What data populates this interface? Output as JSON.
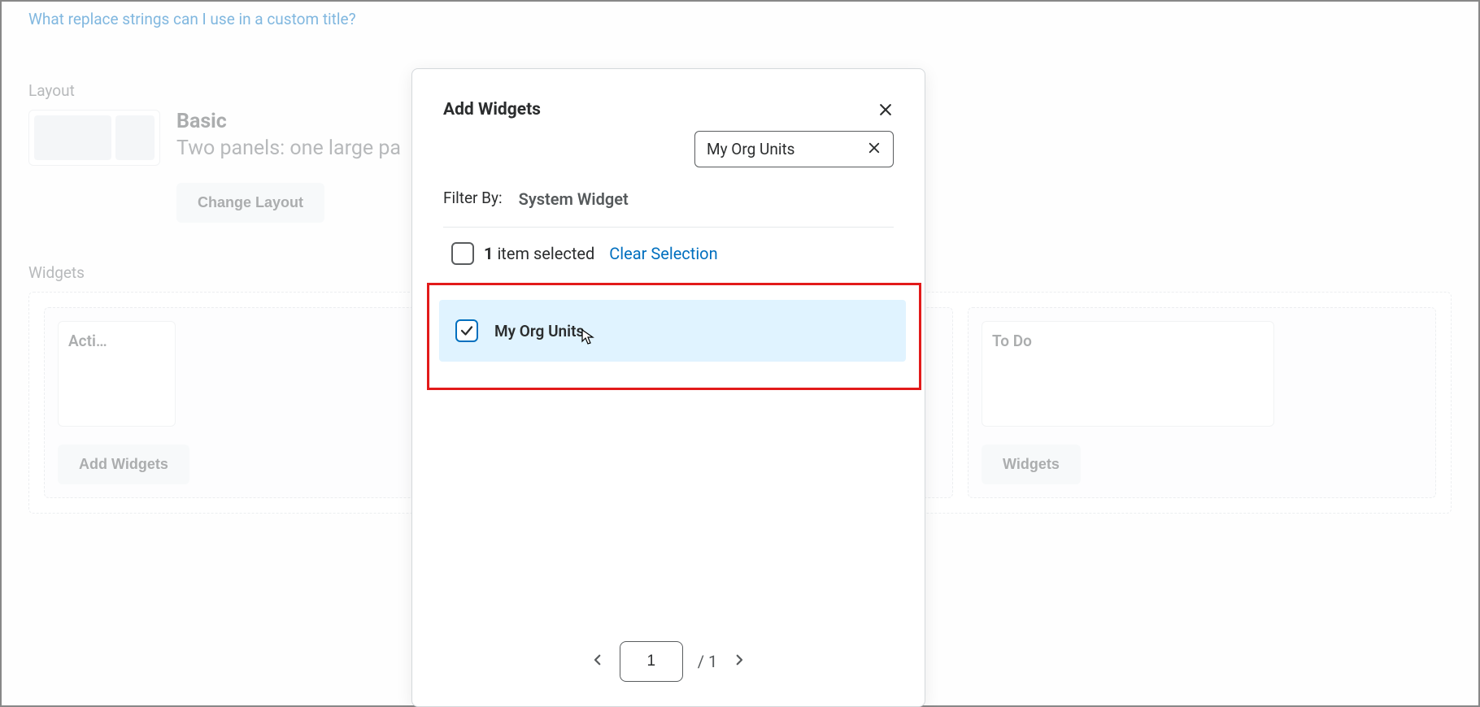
{
  "help_link": "What replace strings can I use in a custom title?",
  "layout": {
    "section_label": "Layout",
    "name": "Basic",
    "description": "Two panels: one large pa",
    "change_button": "Change Layout"
  },
  "widgets": {
    "section_label": "Widgets",
    "panel1_card": "Acti…",
    "panel2_card": "To Do",
    "add_button_1": "Add Widgets",
    "add_button_2": "Widgets"
  },
  "modal": {
    "title": "Add Widgets",
    "search_value": "My Org Units",
    "filter_label": "Filter By:",
    "filter_value": "System Widget",
    "selection": {
      "count": "1",
      "text": " item selected",
      "clear": "Clear Selection"
    },
    "result": {
      "label": "My Org Units"
    },
    "pager": {
      "current": "1",
      "total": "/  1"
    }
  }
}
